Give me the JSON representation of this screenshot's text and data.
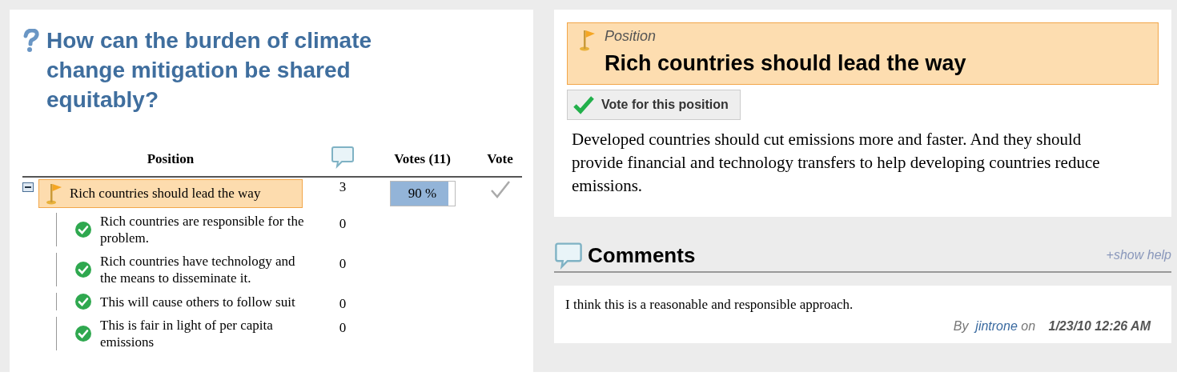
{
  "question": {
    "title": "How can the burden of climate change mitigation be shared equitably?"
  },
  "table": {
    "columns": {
      "position": "Position",
      "votes": "Votes (11)",
      "vote": "Vote"
    },
    "rows": [
      {
        "label": "Rich countries should lead the way",
        "selected": true,
        "expanded": true,
        "count": "3",
        "votes": {
          "level": 0.9,
          "reading": "90 %"
        },
        "voted": false,
        "children": [
          {
            "label": "Rich countries are responsible for the problem.",
            "count": "0"
          },
          {
            "label": "Rich countries have technology and the means to disseminate it.",
            "count": "0"
          },
          {
            "label": "This will cause others to follow suit",
            "count": "0"
          },
          {
            "label": "This is fair in light of per capita emissions",
            "count": "0"
          }
        ]
      }
    ]
  },
  "position": {
    "label": "Position",
    "title": "Rich countries should lead the way",
    "vote_button": "Vote for this position",
    "description": "Developed countries should cut emissions more and faster. And they should provide financial and technology transfers to help developing countries reduce emissions."
  },
  "comments": {
    "title": "Comments",
    "help": "+show help",
    "items": [
      {
        "text": "I think this is a reasonable and responsible approach.",
        "by": "By",
        "author": "jintrone",
        "on": "on",
        "date": "1/23/10 12:26 AM"
      }
    ]
  }
}
